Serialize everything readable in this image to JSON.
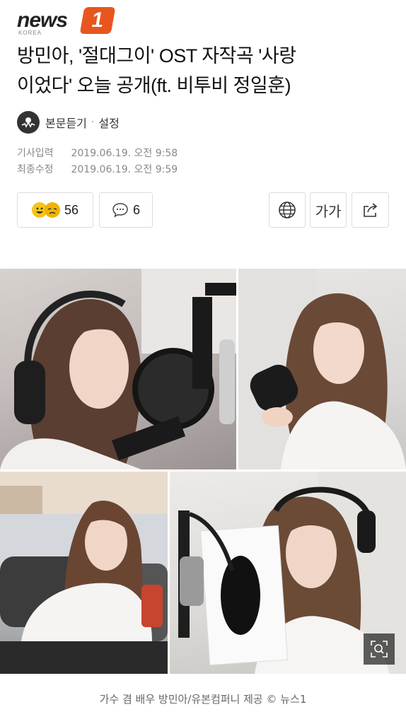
{
  "header": {
    "logo_text": "news",
    "logo_badge": "1",
    "logo_sub": "KOREA"
  },
  "article": {
    "headline_line1": "방민아, '절대그이' OST 자작곡 '사랑",
    "headline_line2": "이었다' 오늘 공개(ft. 비투비 정일훈)",
    "listen_label": "본문듣기",
    "separator": "·",
    "settings_label": "설정",
    "published_label": "기사입력",
    "published_value": "2019.06.19. 오전 9:58",
    "modified_label": "최종수정",
    "modified_value": "2019.06.19. 오전 9:59"
  },
  "actions": {
    "reaction_count": "56",
    "comment_count": "6",
    "font_label": "가가"
  },
  "photos": {
    "caption": "가수 겸 배우 방민아/유본컴퍼니 제공 © 뉴스1"
  },
  "colors": {
    "brand": "#e8561e",
    "meta_text": "#888888",
    "border": "#dddddd"
  }
}
